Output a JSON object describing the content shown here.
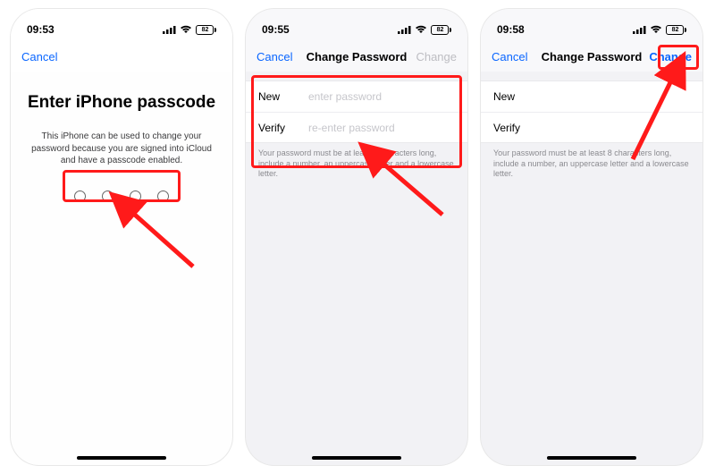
{
  "battery_pct": "82",
  "screens": [
    {
      "time": "09:53",
      "nav": {
        "left": "Cancel",
        "title": "",
        "right": ""
      },
      "passcode": {
        "title": "Enter iPhone passcode",
        "desc": "This iPhone can be used to change your password because you are signed into iCloud and have a passcode enabled."
      }
    },
    {
      "time": "09:55",
      "nav": {
        "left": "Cancel",
        "title": "Change Password",
        "right": "Change",
        "right_active": false
      },
      "form": {
        "new_label": "New",
        "new_placeholder": "enter password",
        "verify_label": "Verify",
        "verify_placeholder": "re-enter password",
        "hint": "Your password must be at least 8 characters long, include a number, an uppercase letter and a lowercase letter."
      }
    },
    {
      "time": "09:58",
      "nav": {
        "left": "Cancel",
        "title": "Change Password",
        "right": "Change",
        "right_active": true
      },
      "form": {
        "new_label": "New",
        "new_placeholder": "",
        "verify_label": "Verify",
        "verify_placeholder": "",
        "hint": "Your password must be at least 8 characters long, include a number, an uppercase letter and a lowercase letter."
      }
    }
  ]
}
